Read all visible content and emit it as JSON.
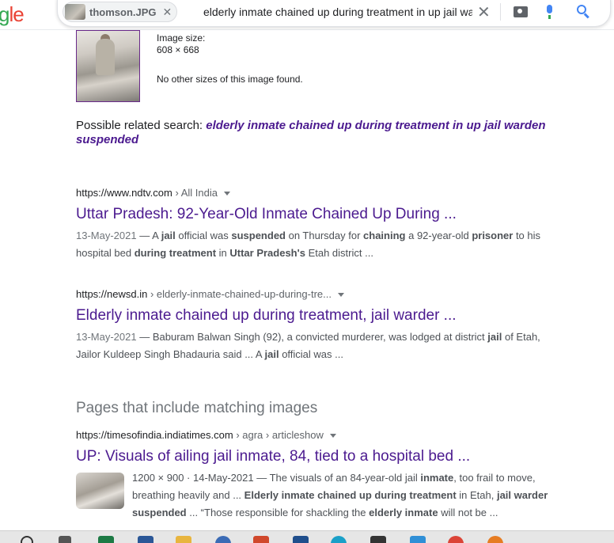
{
  "logo": {
    "text_a": "g",
    "text_b": "le"
  },
  "search": {
    "chip_label": "thomson.JPG",
    "chip_close": "✕",
    "query": "elderly inmate chained up during treatment in up jail wa",
    "clear": "✕"
  },
  "image_info": {
    "size_label": "Image size:",
    "size_value": "608 × 668",
    "no_other": "No other sizes of this image found."
  },
  "related": {
    "prefix": "Possible related search: ",
    "query": "elderly inmate chained up during treatment in up jail warden suspended"
  },
  "results": [
    {
      "domain": "https://www.ndtv.com",
      "crumb": " › All India",
      "title": "Uttar Pradesh: 92-Year-Old Inmate Chained Up During ...",
      "date": "13-May-2021"
    },
    {
      "domain": "https://newsd.in",
      "crumb": " › elderly-inmate-chained-up-during-tre...",
      "title": "Elderly inmate chained up during treatment, jail warder ...",
      "date": "13-May-2021"
    },
    {
      "domain": "https://timesofindia.indiatimes.com",
      "crumb": " › agra › articleshow",
      "title": "UP: Visuals of ailing jail inmate, 84, tied to a hospital bed ...",
      "meta": "1200 × 900 · 14-May-2021"
    }
  ],
  "section_title": "Pages that include matching images",
  "snippet_parts": {
    "r1": [
      "— A ",
      "jail",
      " official was ",
      "suspended",
      " on Thursday for ",
      "chaining",
      " a 92-year-old ",
      "prisoner",
      " to his hospital bed ",
      "during treatment",
      " in ",
      "Uttar Pradesh's",
      " Etah district ..."
    ],
    "r2": [
      "— Baburam Balwan Singh (92), a convicted murderer, was lodged at district ",
      "jail",
      " of Etah, Jailor Kuldeep Singh Bhadauria said ... A ",
      "jail",
      " official was ..."
    ],
    "r3": [
      "— The visuals of an 84-year-old jail ",
      "inmate",
      ", too frail to move, breathing heavily and ... ",
      "Elderly inmate chained up during treatment",
      " in Etah, ",
      "jail warder suspended",
      " ... “Those responsible for shackling the ",
      "elderly inmate",
      " will not be ..."
    ]
  },
  "colors": {
    "visited_link": "#4b1a8f",
    "snippet": "#4d5156",
    "accent": "#4285f4"
  },
  "icons": [
    "camera-icon",
    "microphone-icon",
    "search-icon",
    "close-icon",
    "caret-down-icon"
  ]
}
